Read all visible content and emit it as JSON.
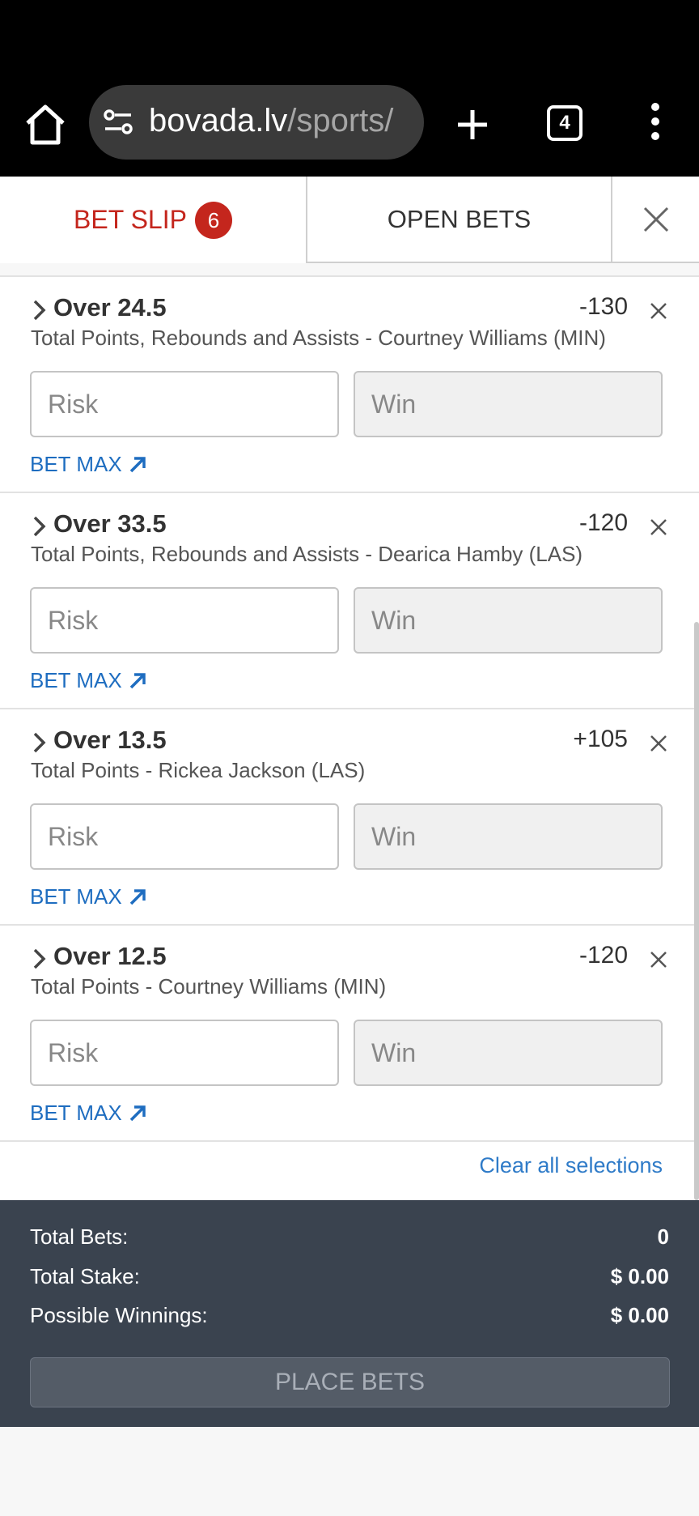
{
  "browser": {
    "url_host": "bovada.lv",
    "url_path": "/sports/",
    "tab_count": "4"
  },
  "header": {
    "bet_slip_label": "BET SLIP",
    "bet_slip_count": "6",
    "open_bets_label": "OPEN BETS"
  },
  "bets": [
    {
      "title": "Over 24.5",
      "odds": "-130",
      "description": "Total Points, Rebounds and Assists - Courtney Williams (MIN)",
      "risk_placeholder": "Risk",
      "win_placeholder": "Win",
      "bet_max_label": "BET MAX"
    },
    {
      "title": "Over 33.5",
      "odds": "-120",
      "description": "Total Points, Rebounds and Assists - Dearica Hamby (LAS)",
      "risk_placeholder": "Risk",
      "win_placeholder": "Win",
      "bet_max_label": "BET MAX"
    },
    {
      "title": "Over 13.5",
      "odds": "+105",
      "description": "Total Points - Rickea Jackson (LAS)",
      "risk_placeholder": "Risk",
      "win_placeholder": "Win",
      "bet_max_label": "BET MAX"
    },
    {
      "title": "Over 12.5",
      "odds": "-120",
      "description": "Total Points - Courtney Williams (MIN)",
      "risk_placeholder": "Risk",
      "win_placeholder": "Win",
      "bet_max_label": "BET MAX"
    }
  ],
  "clear_all_label": "Clear all selections",
  "summary": {
    "total_bets_label": "Total Bets:",
    "total_bets_value": "0",
    "total_stake_label": "Total Stake:",
    "total_stake_value": "$ 0.00",
    "possible_winnings_label": "Possible Winnings:",
    "possible_winnings_value": "$ 0.00",
    "place_bets_label": "PLACE BETS"
  },
  "colors": {
    "accent_red": "#c4261d",
    "link_blue": "#1e6dc0",
    "summary_bg": "#3a434f"
  }
}
